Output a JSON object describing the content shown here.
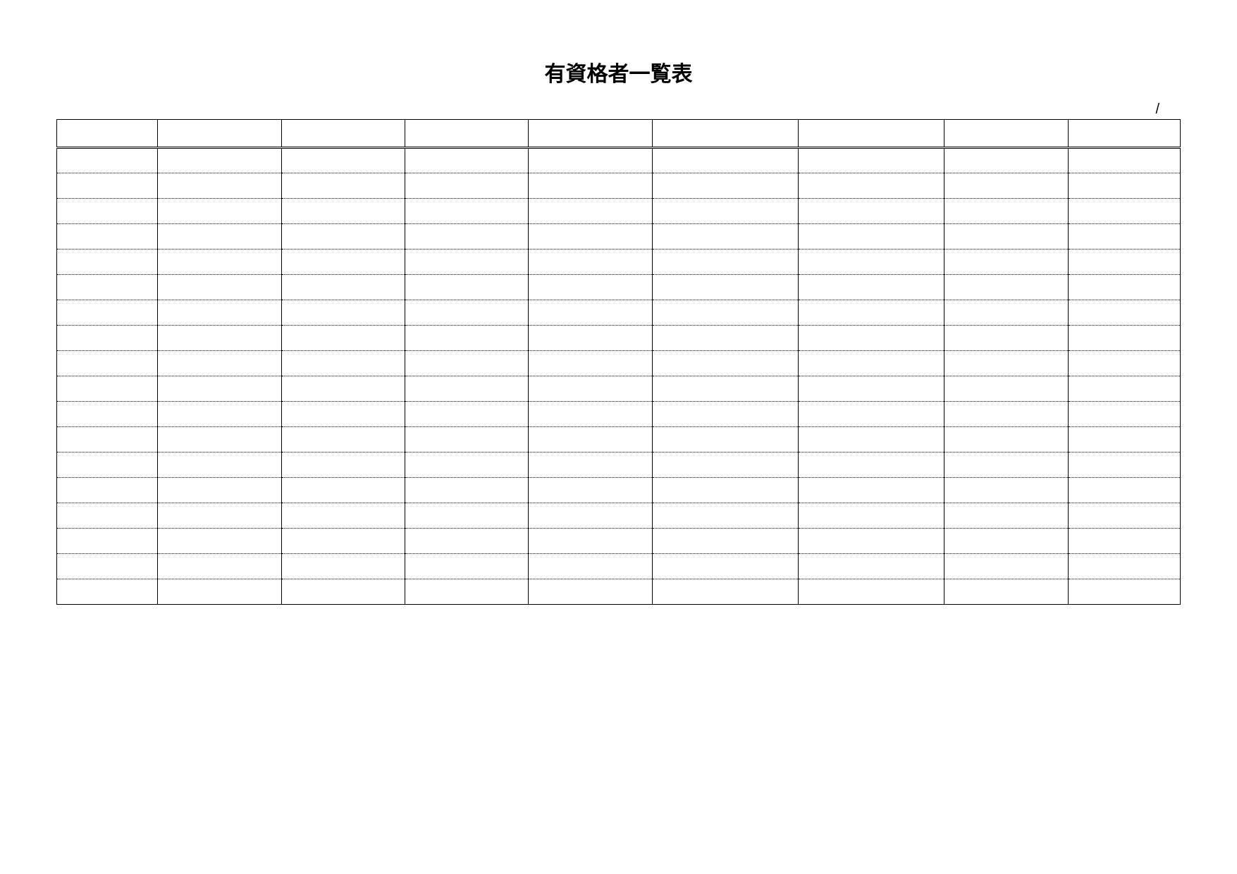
{
  "title": "有資格者一覧表",
  "page_separator": "/",
  "table": {
    "columns": [
      "",
      "",
      "",
      "",
      "",
      "",
      "",
      "",
      ""
    ],
    "rows": [
      [
        "",
        "",
        "",
        "",
        "",
        "",
        "",
        "",
        ""
      ],
      [
        "",
        "",
        "",
        "",
        "",
        "",
        "",
        "",
        ""
      ],
      [
        "",
        "",
        "",
        "",
        "",
        "",
        "",
        "",
        ""
      ],
      [
        "",
        "",
        "",
        "",
        "",
        "",
        "",
        "",
        ""
      ],
      [
        "",
        "",
        "",
        "",
        "",
        "",
        "",
        "",
        ""
      ],
      [
        "",
        "",
        "",
        "",
        "",
        "",
        "",
        "",
        ""
      ],
      [
        "",
        "",
        "",
        "",
        "",
        "",
        "",
        "",
        ""
      ],
      [
        "",
        "",
        "",
        "",
        "",
        "",
        "",
        "",
        ""
      ],
      [
        "",
        "",
        "",
        "",
        "",
        "",
        "",
        "",
        ""
      ],
      [
        "",
        "",
        "",
        "",
        "",
        "",
        "",
        "",
        ""
      ],
      [
        "",
        "",
        "",
        "",
        "",
        "",
        "",
        "",
        ""
      ],
      [
        "",
        "",
        "",
        "",
        "",
        "",
        "",
        "",
        ""
      ],
      [
        "",
        "",
        "",
        "",
        "",
        "",
        "",
        "",
        ""
      ],
      [
        "",
        "",
        "",
        "",
        "",
        "",
        "",
        "",
        ""
      ],
      [
        "",
        "",
        "",
        "",
        "",
        "",
        "",
        "",
        ""
      ],
      [
        "",
        "",
        "",
        "",
        "",
        "",
        "",
        "",
        ""
      ],
      [
        "",
        "",
        "",
        "",
        "",
        "",
        "",
        "",
        ""
      ],
      [
        "",
        "",
        "",
        "",
        "",
        "",
        "",
        "",
        ""
      ]
    ]
  }
}
